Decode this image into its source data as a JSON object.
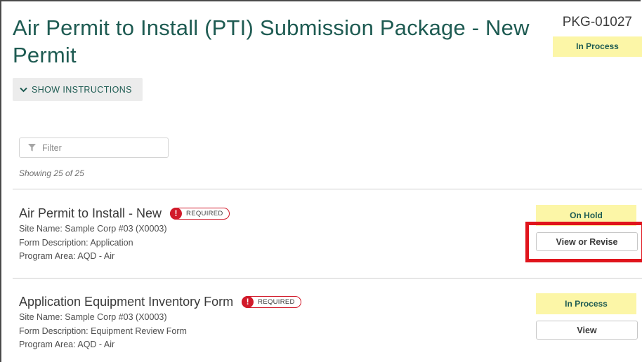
{
  "header": {
    "title": "Air Permit to Install (PTI) Submission Package - New Permit",
    "package_id": "PKG-01027",
    "status": "In Process"
  },
  "instructions_toggle": {
    "label": "SHOW INSTRUCTIONS",
    "icon": "chevron-down-icon"
  },
  "filter": {
    "placeholder": "Filter",
    "value": "",
    "icon": "funnel-icon"
  },
  "showing_text": "Showing 25 of 25",
  "forms": [
    {
      "title": "Air Permit to Install - New",
      "required_label": "REQUIRED",
      "site_name": "Site Name: Sample Corp #03 (X0003)",
      "form_description": "Form Description: Application",
      "program_area": "Program Area: AQD - Air",
      "status": "On Hold",
      "action_label": "View or Revise"
    },
    {
      "title": "Application Equipment Inventory Form",
      "required_label": "REQUIRED",
      "site_name": "Site Name: Sample Corp #03 (X0003)",
      "form_description": "Form Description: Equipment Review Form",
      "program_area": "Program Area: AQD - Air",
      "status": "In Process",
      "action_label": "View"
    }
  ],
  "colors": {
    "title_green": "#1e5b52",
    "status_yellow": "#fcf6a7",
    "required_red": "#d11a2a",
    "annotation_red": "#e0141c"
  }
}
